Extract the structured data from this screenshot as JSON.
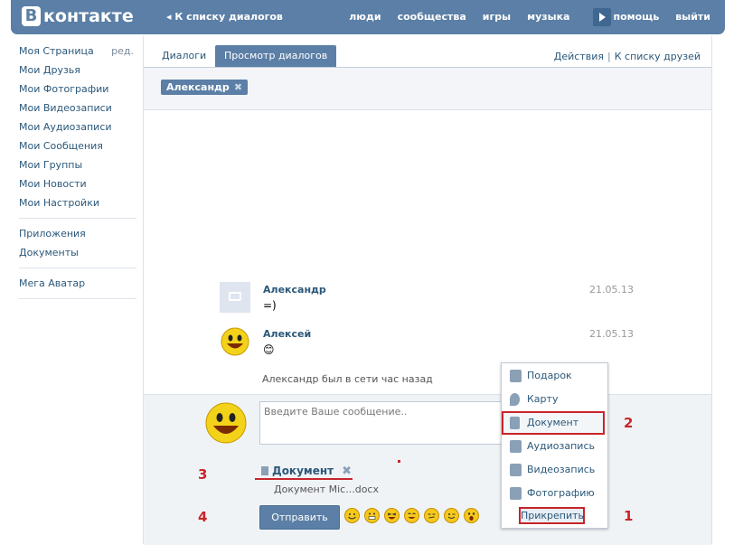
{
  "header": {
    "logo_letter": "В",
    "logo_text": "контакте",
    "back_link": "К списку диалогов",
    "nav": [
      "люди",
      "сообщества",
      "игры",
      "музыка",
      "помощь",
      "выйти"
    ]
  },
  "left_menu": {
    "edit_label": "ред.",
    "items": [
      "Моя Страница",
      "Мои Друзья",
      "Мои Фотографии",
      "Мои Видеозаписи",
      "Мои Аудиозаписи",
      "Мои Сообщения",
      "Мои Группы",
      "Мои Новости",
      "Мои Настройки"
    ],
    "extra": [
      "Приложения",
      "Документы"
    ],
    "apps": [
      "Мега Аватар"
    ]
  },
  "tabs": {
    "dialogs": "Диалоги",
    "view": "Просмотр диалогов",
    "actions": "Действия",
    "friends": "К списку друзей"
  },
  "chip": {
    "name": "Александр",
    "close": "✖"
  },
  "messages": [
    {
      "name": "Александр",
      "text": "=)",
      "date": "21.05.13"
    },
    {
      "name": "Алексей",
      "text": "😊",
      "date": "21.05.13"
    }
  ],
  "status": "Александр был в сети час назад",
  "compose": {
    "placeholder": "Введите Ваше сообщение..",
    "doc_title": "Документ",
    "doc_close": "✖",
    "doc_file": "Документ Mic...docx",
    "send": "Отправить"
  },
  "annotations": [
    "1",
    "2",
    "3",
    "4"
  ],
  "attach_menu": {
    "items": [
      "Подарок",
      "Карту",
      "Документ",
      "Аудиозапись",
      "Видеозапись",
      "Фотографию"
    ],
    "attach_button": "Прикрепить"
  },
  "colors": {
    "brand": "#5b7fa6",
    "link": "#2b587a",
    "highlight": "#c8242b"
  }
}
